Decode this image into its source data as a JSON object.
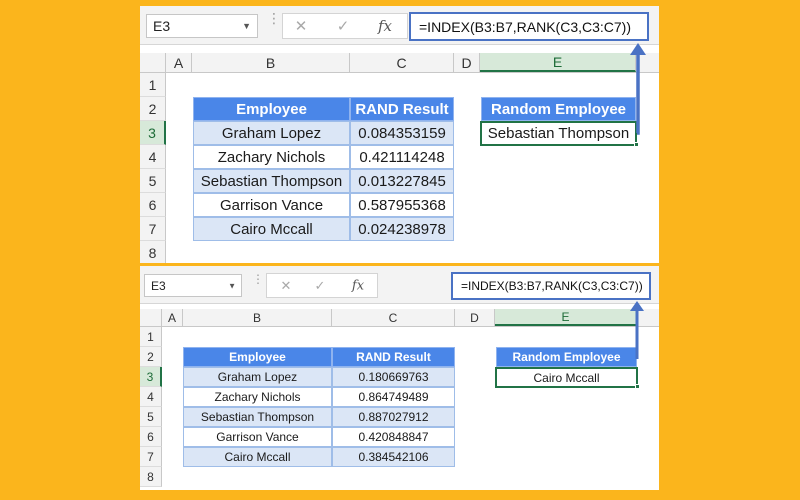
{
  "panels": [
    {
      "name_box": "E3",
      "formula_buttons": {
        "cancel": "✕",
        "enter": "✓",
        "fx": "fx"
      },
      "formula": "=INDEX(B3:B7,RANK(C3,C3:C7))",
      "columns": [
        "A",
        "B",
        "C",
        "D",
        "E"
      ],
      "rows": [
        "1",
        "2",
        "3",
        "4",
        "5",
        "6",
        "7",
        "8"
      ],
      "table": {
        "headers": [
          "Employee",
          "RAND Result"
        ],
        "rows": [
          [
            "Graham Lopez",
            "0.084353159"
          ],
          [
            "Zachary Nichols",
            "0.421114248"
          ],
          [
            "Sebastian Thompson",
            "0.013227845"
          ],
          [
            "Garrison Vance",
            "0.587955368"
          ],
          [
            "Cairo Mccall",
            "0.024238978"
          ]
        ]
      },
      "result_header": "Random Employee",
      "result_value": "Sebastian Thompson"
    },
    {
      "name_box": "E3",
      "formula_buttons": {
        "cancel": "✕",
        "enter": "✓",
        "fx": "fx"
      },
      "formula": "=INDEX(B3:B7,RANK(C3,C3:C7))",
      "columns": [
        "A",
        "B",
        "C",
        "D",
        "E"
      ],
      "rows": [
        "1",
        "2",
        "3",
        "4",
        "5",
        "6",
        "7",
        "8"
      ],
      "table": {
        "headers": [
          "Employee",
          "RAND Result"
        ],
        "rows": [
          [
            "Graham Lopez",
            "0.180669763"
          ],
          [
            "Zachary Nichols",
            "0.864749489"
          ],
          [
            "Sebastian Thompson",
            "0.887027912"
          ],
          [
            "Garrison Vance",
            "0.420848847"
          ],
          [
            "Cairo Mccall",
            "0.384542106"
          ]
        ]
      },
      "result_header": "Random Employee",
      "result_value": "Cairo Mccall"
    }
  ],
  "colors": {
    "background": "#fbb51c",
    "table_header": "#4a86e8",
    "band": "#dbe6f6",
    "selection": "#217346",
    "arrow": "#4a72c4"
  }
}
